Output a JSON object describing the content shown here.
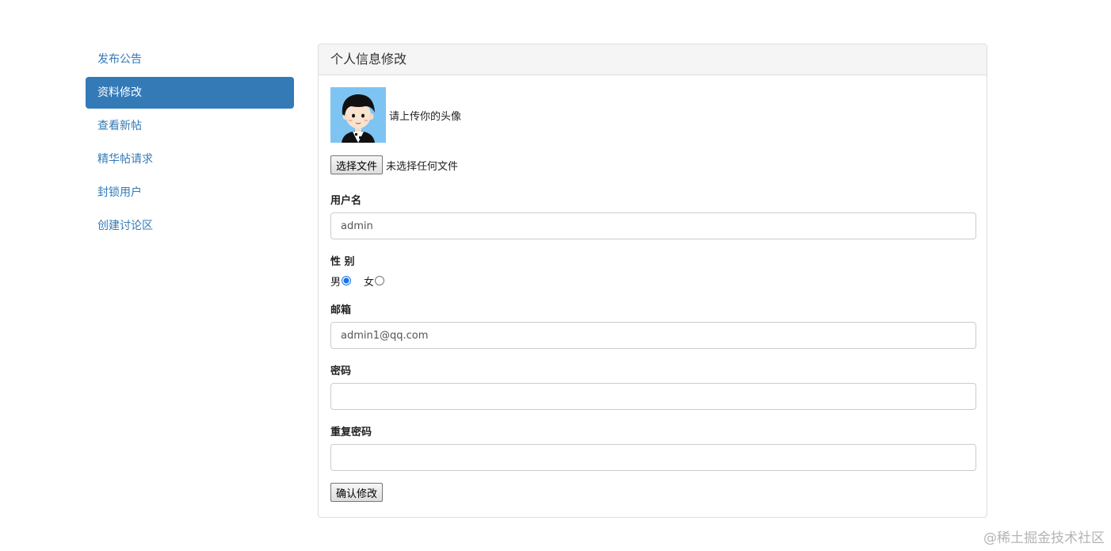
{
  "sidebar": {
    "items": [
      {
        "label": "发布公告",
        "active": false
      },
      {
        "label": "资料修改",
        "active": true
      },
      {
        "label": "查看新帖",
        "active": false
      },
      {
        "label": "精华帖请求",
        "active": false
      },
      {
        "label": "封锁用户",
        "active": false
      },
      {
        "label": "创建讨论区",
        "active": false
      }
    ]
  },
  "panel": {
    "title": "个人信息修改",
    "avatar_hint": "请上传你的头像",
    "file_button_label": "选择文件",
    "file_status": "未选择任何文件",
    "username": {
      "label": "用户名",
      "value": "admin"
    },
    "gender": {
      "label": "性 别",
      "options": [
        {
          "label": "男",
          "checked": true
        },
        {
          "label": "女",
          "checked": false
        }
      ]
    },
    "email": {
      "label": "邮箱",
      "value": "admin1@qq.com"
    },
    "password": {
      "label": "密码",
      "value": ""
    },
    "password_repeat": {
      "label": "重复密码",
      "value": ""
    },
    "submit_label": "确认修改"
  },
  "watermark": "@稀土掘金技术社区",
  "colors": {
    "accent": "#337ab7",
    "avatar_bg": "#7ec4f3",
    "heading_bg": "#f5f5f5"
  }
}
